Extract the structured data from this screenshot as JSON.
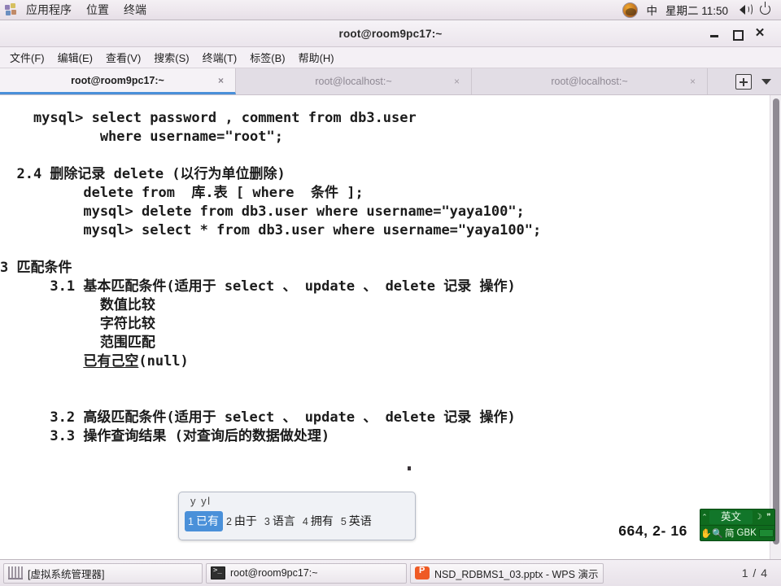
{
  "desktop": {
    "panel": {
      "apps_icon": "applications-icon",
      "menus": [
        "应用程序",
        "位置",
        "终端"
      ],
      "avatar": "user-avatar",
      "ime_indicator": "中",
      "clock": "星期二 11:50",
      "volume_icon": "speaker-icon",
      "power_icon": "power-icon"
    },
    "taskbar": {
      "buttons": [
        {
          "icon": "virtual-machine-manager-icon",
          "label": "[虚拟系统管理器]"
        },
        {
          "icon": "terminal-icon",
          "label": "root@room9pc17:~"
        },
        {
          "icon": "wps-presentation-icon",
          "label": "NSD_RDBMS1_03.pptx - WPS 演示"
        }
      ],
      "pager": "1 / 4"
    }
  },
  "terminal": {
    "window_title": "root@room9pc17:~",
    "window_buttons": {
      "minimize": "minimize-icon",
      "maximize": "maximize-icon",
      "close": "close-icon"
    },
    "menubar": [
      "文件(F)",
      "编辑(E)",
      "查看(V)",
      "搜索(S)",
      "终端(T)",
      "标签(B)",
      "帮助(H)"
    ],
    "tabs": [
      {
        "label": "root@room9pc17:~",
        "active": true,
        "close": "×"
      },
      {
        "label": "root@localhost:~",
        "active": false,
        "close": "×"
      },
      {
        "label": "root@localhost:~",
        "active": false,
        "close": "×"
      }
    ],
    "tab_tools": {
      "new_tab": "new-tab-icon",
      "tab_list": "chevron-down-icon"
    },
    "content_lines": [
      "    mysql> select password , comment from db3.user",
      "            where username=\"root\";",
      "",
      "  2.4 删除记录 delete (以行为单位删除)",
      "          delete from  库.表 [ where  条件 ];",
      "          mysql> delete from db3.user where username=\"yaya100\";",
      "          mysql> select * from db3.user where username=\"yaya100\";",
      "",
      "3 匹配条件",
      "      3.1 基本匹配条件(适用于 select 、 update 、 delete 记录 操作)",
      "            数值比较",
      "            字符比较",
      "            范围匹配",
      "          已有己空(null)",
      "",
      "",
      "      3.2 高级匹配条件(适用于 select 、 update 、 delete 记录 操作)",
      "      3.3 操作查询结果 (对查询后的数据做处理)"
    ],
    "preedit_line_index": 13,
    "preedit_text": "已有己空",
    "cursor_position": "664, 2- 16",
    "scrollbar": "vertical-scrollbar"
  },
  "ime": {
    "preedit": "y yl",
    "candidates": [
      {
        "num": "1",
        "word": "已有",
        "selected": true
      },
      {
        "num": "2",
        "word": "由于",
        "selected": false
      },
      {
        "num": "3",
        "word": "语言",
        "selected": false
      },
      {
        "num": "4",
        "word": "拥有",
        "selected": false
      },
      {
        "num": "5",
        "word": "英语",
        "selected": false
      }
    ],
    "status_bar": {
      "language": "英文",
      "script": "简",
      "encoding": "GBK",
      "moon_icon": "moon-icon",
      "quote_icon": "quote-icon",
      "hand_icon": "hand-icon",
      "search_icon": "search-icon",
      "keyboard_icon": "keyboard-icon"
    }
  },
  "colors": {
    "accent": "#4a90d9",
    "panel_bg": "#eee8ee",
    "terminal_bg": "#ffffff",
    "terminal_fg": "#1b1b1b",
    "ime_green": "#0f6b1e",
    "wps_orange": "#ef5a24"
  }
}
